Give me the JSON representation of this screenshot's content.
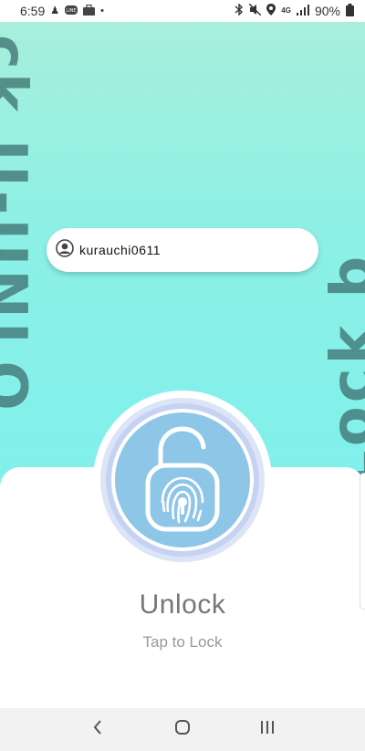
{
  "status_bar": {
    "time": "6:59",
    "network": "4G",
    "battery": "90%",
    "left_icons": [
      "person-walk-icon",
      "line-app-icon",
      "briefcase-icon",
      "dot-icon"
    ],
    "right_icons": [
      "bluetooth-icon",
      "mute-icon",
      "location-icon",
      "signal-icon",
      "battery-icon"
    ]
  },
  "background": {
    "left_text": "ck U-UNLO",
    "right_text": "Lock b",
    "gradient_top": "#a7efdb",
    "gradient_bottom": "#7ff0ec"
  },
  "user": {
    "username": "kurauchi0611",
    "icon": "user-avatar-icon"
  },
  "lock": {
    "state_label": "Unlock",
    "hint": "Tap to Lock",
    "icon": "fingerprint-padlock-icon",
    "accent": "#8ec6e8"
  },
  "nav": {
    "back_icon": "back-icon",
    "home_icon": "home-icon",
    "recents_icon": "recents-icon"
  }
}
